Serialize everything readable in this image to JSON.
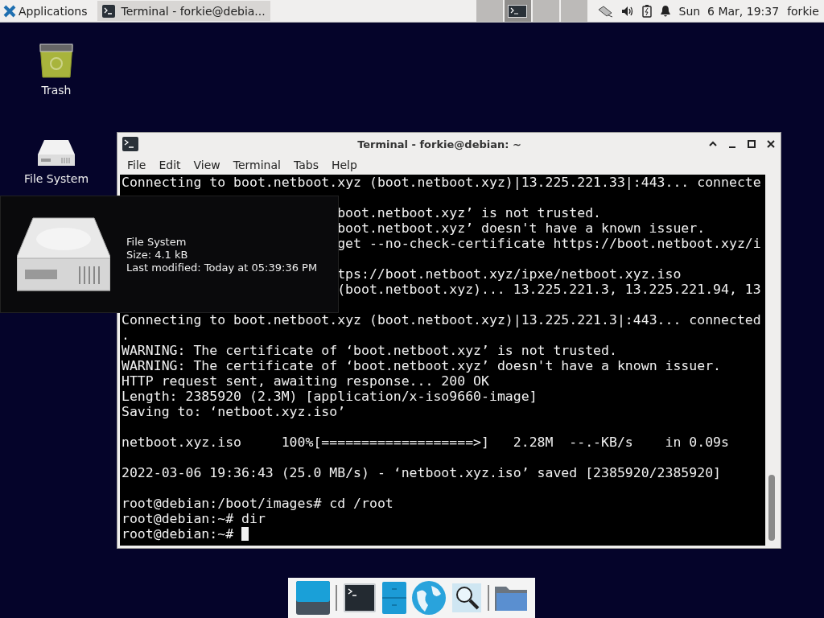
{
  "panel": {
    "menu": "Applications",
    "tasks": [
      {
        "title": "Terminal - forkie@debia...",
        "selected": true
      }
    ],
    "workspaces": [
      {
        "selected": false
      },
      {
        "selected": true
      },
      {
        "selected": false
      },
      {
        "selected": false
      }
    ],
    "clock": "Sun  6 Mar, 19:37",
    "user": "forkie"
  },
  "desktop_icons": [
    {
      "label": "Trash",
      "kind": "trash"
    },
    {
      "label": "File System",
      "kind": "drive"
    }
  ],
  "terminal": {
    "title": "Terminal - forkie@debian: ~",
    "menu": [
      "File",
      "Edit",
      "View",
      "Terminal",
      "Tabs",
      "Help"
    ],
    "lines": [
      {
        "kind": "full",
        "text": "Connecting to boot.netboot.xyz (boot.netboot.xyz)|13.225.221.33|:443... connecte"
      },
      {
        "kind": "hidden"
      },
      {
        "kind": "tail",
        "text": "boot.netboot.xyz’ is not trusted."
      },
      {
        "kind": "tail",
        "text": "boot.netboot.xyz’ doesn't have a known issuer."
      },
      {
        "kind": "tail",
        "text": "get --no-check-certificate https://boot.netboot.xyz/i"
      },
      {
        "kind": "hidden"
      },
      {
        "kind": "tail",
        "text": "tps://boot.netboot.xyz/ipxe/netboot.xyz.iso"
      },
      {
        "kind": "tail",
        "text": "(boot.netboot.xyz)... 13.225.221.3, 13.225.221.94, 13"
      },
      {
        "kind": "hidden"
      },
      {
        "kind": "full",
        "text": "Connecting to boot.netboot.xyz (boot.netboot.xyz)|13.225.221.3|:443... connected"
      },
      {
        "kind": "full",
        "text": "."
      },
      {
        "kind": "full",
        "text": "WARNING: The certificate of ‘boot.netboot.xyz’ is not trusted."
      },
      {
        "kind": "full",
        "text": "WARNING: The certificate of ‘boot.netboot.xyz’ doesn't have a known issuer."
      },
      {
        "kind": "full",
        "text": "HTTP request sent, awaiting response... 200 OK"
      },
      {
        "kind": "full",
        "text": "Length: 2385920 (2.3M) [application/x-iso9660-image]"
      },
      {
        "kind": "full",
        "text": "Saving to: ‘netboot.xyz.iso’"
      },
      {
        "kind": "blank"
      },
      {
        "kind": "full",
        "text": "netboot.xyz.iso     100%[===================>]   2.28M  --.-KB/s    in 0.09s"
      },
      {
        "kind": "blank"
      },
      {
        "kind": "full",
        "text": "2022-03-06 19:36:43 (25.0 MB/s) - ‘netboot.xyz.iso’ saved [2385920/2385920]"
      },
      {
        "kind": "blank"
      },
      {
        "kind": "full",
        "text": "root@debian:/boot/images# cd /root"
      },
      {
        "kind": "full",
        "text": "root@debian:~# dir"
      }
    ],
    "prompt": "root@debian:~# "
  },
  "tooltip": {
    "title": "File System",
    "size": "Size: 4.1 kB",
    "modified": "Last modified: Today at 05:39:36 PM"
  },
  "dock": [
    {
      "kind": "desktop"
    },
    {
      "kind": "terminal"
    },
    {
      "kind": "files"
    },
    {
      "kind": "browser"
    },
    {
      "kind": "search"
    },
    {
      "kind": "folder"
    }
  ]
}
